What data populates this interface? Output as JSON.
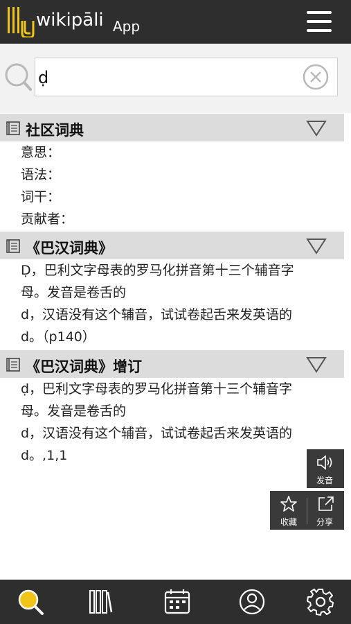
{
  "header": {
    "logo_text": "wikipāli",
    "app_label": "App",
    "menu_icon": "hamburger-menu-icon"
  },
  "search": {
    "value": "ḍ",
    "placeholder": ""
  },
  "sections": [
    {
      "title": "社区词典",
      "fields": [
        "意思：",
        "语法：",
        "词干：",
        "贡献者："
      ]
    },
    {
      "title": "《巴汉词典》",
      "lines": [
        "Ḍ，巴利文字母表的罗马化拼音第十三个辅音字",
        "母。发音是卷舌的",
        "d，汉语没有这个辅音，试试卷起舌来发英语的",
        "d。（p140）"
      ]
    },
    {
      "title": "《巴汉词典》增订",
      "lines": [
        "ḍ，巴利文字母表的罗马化拼音第十三个辅音字",
        "母。发音是卷舌的",
        "d，汉语没有这个辅音，试试卷起舌来发英语的",
        "d。,1,1"
      ]
    }
  ],
  "actions": {
    "pronounce_label": "发音",
    "favorite_label": "收藏",
    "share_label": "分享"
  },
  "bottom_nav": [
    "search-icon",
    "library-icon",
    "calendar-icon",
    "user-icon",
    "settings-icon"
  ],
  "colors": {
    "header_bg": "#2e2e2e",
    "accent": "#f0c419",
    "section_bg": "#dcdcdc"
  }
}
